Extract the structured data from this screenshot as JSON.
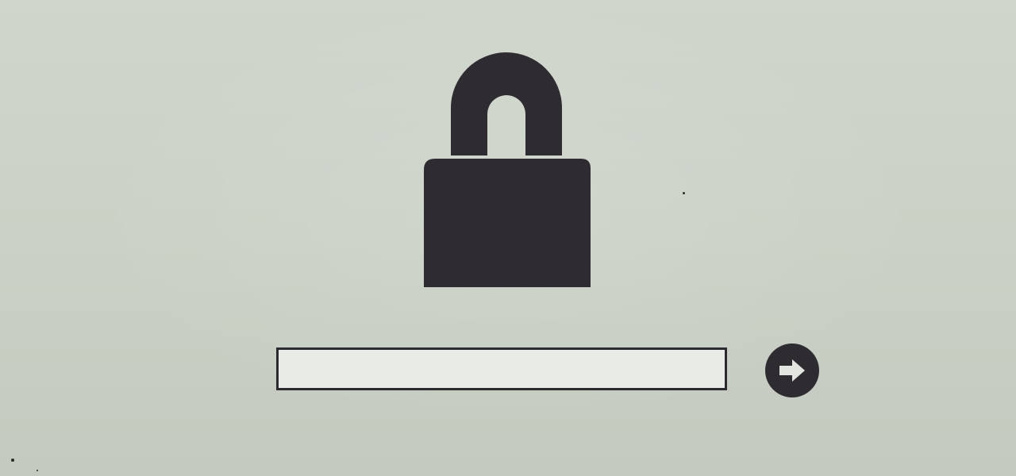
{
  "screen": {
    "name": "lock-screen"
  },
  "lock": {
    "icon": "padlock-icon",
    "color": "#2e2b31"
  },
  "password": {
    "value": "",
    "placeholder": ""
  },
  "login_button": {
    "icon": "arrow-right-icon",
    "color": "#2e2c31"
  },
  "colors": {
    "background": "#cbd2c7",
    "field_background": "#e9ebe6",
    "field_border": "#2b2a2e"
  }
}
